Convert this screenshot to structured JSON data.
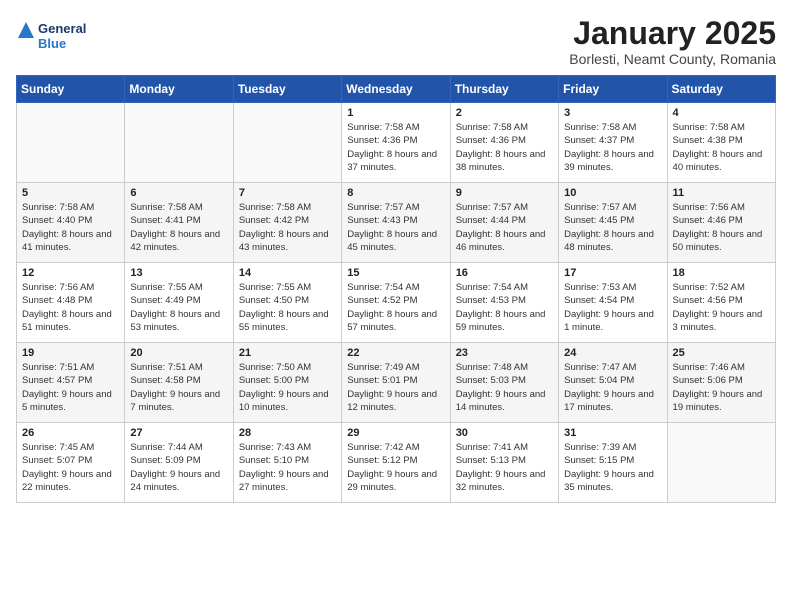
{
  "logo": {
    "line1": "General",
    "line2": "Blue"
  },
  "title": "January 2025",
  "subtitle": "Borlesti, Neamt County, Romania",
  "days_header": [
    "Sunday",
    "Monday",
    "Tuesday",
    "Wednesday",
    "Thursday",
    "Friday",
    "Saturday"
  ],
  "weeks": [
    [
      {
        "day": "",
        "info": ""
      },
      {
        "day": "",
        "info": ""
      },
      {
        "day": "",
        "info": ""
      },
      {
        "day": "1",
        "info": "Sunrise: 7:58 AM\nSunset: 4:36 PM\nDaylight: 8 hours and 37 minutes."
      },
      {
        "day": "2",
        "info": "Sunrise: 7:58 AM\nSunset: 4:36 PM\nDaylight: 8 hours and 38 minutes."
      },
      {
        "day": "3",
        "info": "Sunrise: 7:58 AM\nSunset: 4:37 PM\nDaylight: 8 hours and 39 minutes."
      },
      {
        "day": "4",
        "info": "Sunrise: 7:58 AM\nSunset: 4:38 PM\nDaylight: 8 hours and 40 minutes."
      }
    ],
    [
      {
        "day": "5",
        "info": "Sunrise: 7:58 AM\nSunset: 4:40 PM\nDaylight: 8 hours and 41 minutes."
      },
      {
        "day": "6",
        "info": "Sunrise: 7:58 AM\nSunset: 4:41 PM\nDaylight: 8 hours and 42 minutes."
      },
      {
        "day": "7",
        "info": "Sunrise: 7:58 AM\nSunset: 4:42 PM\nDaylight: 8 hours and 43 minutes."
      },
      {
        "day": "8",
        "info": "Sunrise: 7:57 AM\nSunset: 4:43 PM\nDaylight: 8 hours and 45 minutes."
      },
      {
        "day": "9",
        "info": "Sunrise: 7:57 AM\nSunset: 4:44 PM\nDaylight: 8 hours and 46 minutes."
      },
      {
        "day": "10",
        "info": "Sunrise: 7:57 AM\nSunset: 4:45 PM\nDaylight: 8 hours and 48 minutes."
      },
      {
        "day": "11",
        "info": "Sunrise: 7:56 AM\nSunset: 4:46 PM\nDaylight: 8 hours and 50 minutes."
      }
    ],
    [
      {
        "day": "12",
        "info": "Sunrise: 7:56 AM\nSunset: 4:48 PM\nDaylight: 8 hours and 51 minutes."
      },
      {
        "day": "13",
        "info": "Sunrise: 7:55 AM\nSunset: 4:49 PM\nDaylight: 8 hours and 53 minutes."
      },
      {
        "day": "14",
        "info": "Sunrise: 7:55 AM\nSunset: 4:50 PM\nDaylight: 8 hours and 55 minutes."
      },
      {
        "day": "15",
        "info": "Sunrise: 7:54 AM\nSunset: 4:52 PM\nDaylight: 8 hours and 57 minutes."
      },
      {
        "day": "16",
        "info": "Sunrise: 7:54 AM\nSunset: 4:53 PM\nDaylight: 8 hours and 59 minutes."
      },
      {
        "day": "17",
        "info": "Sunrise: 7:53 AM\nSunset: 4:54 PM\nDaylight: 9 hours and 1 minute."
      },
      {
        "day": "18",
        "info": "Sunrise: 7:52 AM\nSunset: 4:56 PM\nDaylight: 9 hours and 3 minutes."
      }
    ],
    [
      {
        "day": "19",
        "info": "Sunrise: 7:51 AM\nSunset: 4:57 PM\nDaylight: 9 hours and 5 minutes."
      },
      {
        "day": "20",
        "info": "Sunrise: 7:51 AM\nSunset: 4:58 PM\nDaylight: 9 hours and 7 minutes."
      },
      {
        "day": "21",
        "info": "Sunrise: 7:50 AM\nSunset: 5:00 PM\nDaylight: 9 hours and 10 minutes."
      },
      {
        "day": "22",
        "info": "Sunrise: 7:49 AM\nSunset: 5:01 PM\nDaylight: 9 hours and 12 minutes."
      },
      {
        "day": "23",
        "info": "Sunrise: 7:48 AM\nSunset: 5:03 PM\nDaylight: 9 hours and 14 minutes."
      },
      {
        "day": "24",
        "info": "Sunrise: 7:47 AM\nSunset: 5:04 PM\nDaylight: 9 hours and 17 minutes."
      },
      {
        "day": "25",
        "info": "Sunrise: 7:46 AM\nSunset: 5:06 PM\nDaylight: 9 hours and 19 minutes."
      }
    ],
    [
      {
        "day": "26",
        "info": "Sunrise: 7:45 AM\nSunset: 5:07 PM\nDaylight: 9 hours and 22 minutes."
      },
      {
        "day": "27",
        "info": "Sunrise: 7:44 AM\nSunset: 5:09 PM\nDaylight: 9 hours and 24 minutes."
      },
      {
        "day": "28",
        "info": "Sunrise: 7:43 AM\nSunset: 5:10 PM\nDaylight: 9 hours and 27 minutes."
      },
      {
        "day": "29",
        "info": "Sunrise: 7:42 AM\nSunset: 5:12 PM\nDaylight: 9 hours and 29 minutes."
      },
      {
        "day": "30",
        "info": "Sunrise: 7:41 AM\nSunset: 5:13 PM\nDaylight: 9 hours and 32 minutes."
      },
      {
        "day": "31",
        "info": "Sunrise: 7:39 AM\nSunset: 5:15 PM\nDaylight: 9 hours and 35 minutes."
      },
      {
        "day": "",
        "info": ""
      }
    ]
  ]
}
